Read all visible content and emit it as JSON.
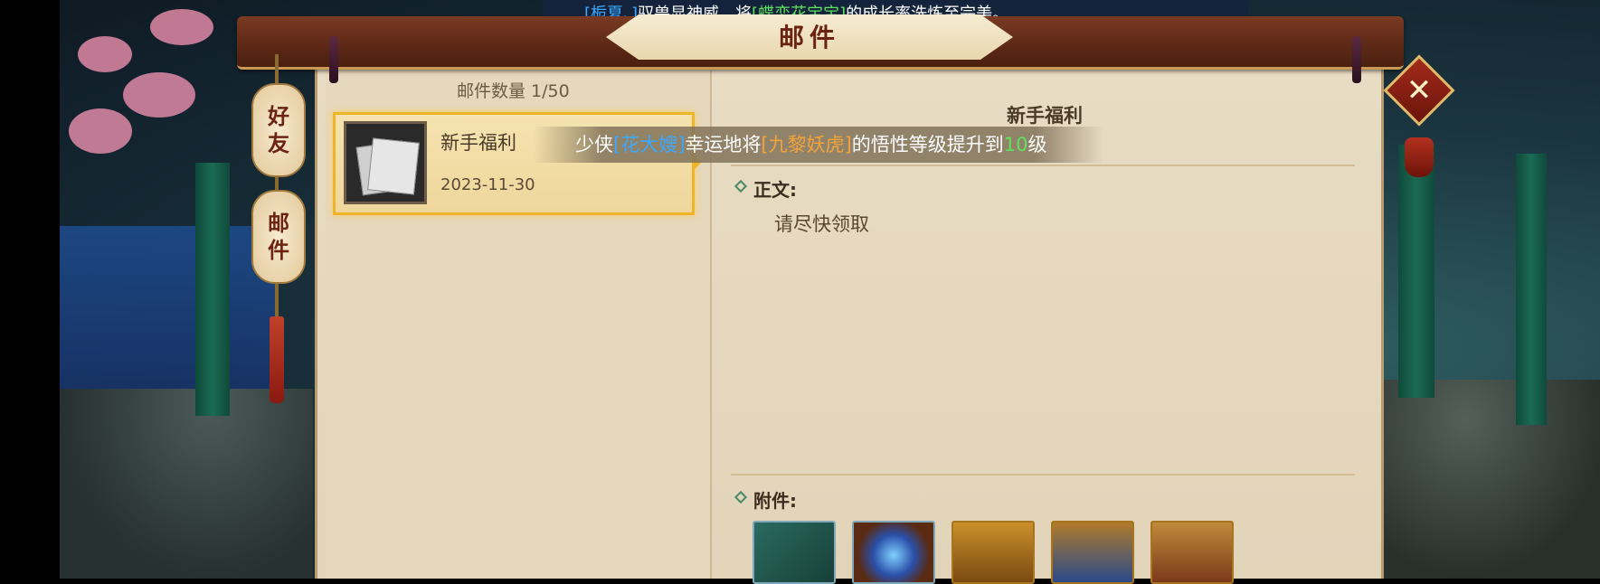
{
  "announcement": {
    "name_prefix": "[栀夏、]",
    "middle": "驭兽显神威，将",
    "pet": "[蝶恋花宝宝]",
    "suffix": "的成长率洗炼至完美。"
  },
  "window": {
    "title": "邮件",
    "close_icon": "close-x-icon"
  },
  "side_tabs": [
    {
      "label_line1": "好",
      "label_line2": "友"
    },
    {
      "label_line1": "邮",
      "label_line2": "件"
    }
  ],
  "mail_list": {
    "count_label": "邮件数量 1/50",
    "items": [
      {
        "title": "新手福利",
        "date": "2023-11-30",
        "icon": "letter-icon"
      }
    ]
  },
  "mail_detail": {
    "title": "新手福利",
    "body_label": "正文:",
    "body_text": "请尽快领取",
    "attachments_label": "附件:",
    "attachments": [
      {
        "icon": "jade-token-icon"
      },
      {
        "icon": "orb-icon"
      },
      {
        "icon": "gold-ingot-icon"
      },
      {
        "icon": "dragon-chest-icon"
      },
      {
        "icon": "tiger-chest-icon"
      }
    ]
  },
  "toast": {
    "prefix": "少侠",
    "player": "[花大嫂]",
    "middle": "幸运地将",
    "pet": "[九黎妖虎]",
    "middle2": "的悟性等级提升到",
    "level": "10",
    "suffix": "级"
  },
  "colors": {
    "name_blue": "#3aa8ff",
    "pet_green": "#5fe05f",
    "pet_orange": "#f2a43a",
    "panel_bg": "#e8dcc4",
    "title_bar": "#5d2816"
  }
}
